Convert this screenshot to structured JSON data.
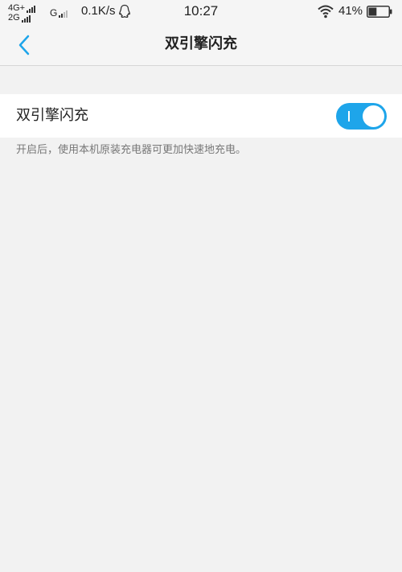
{
  "status_bar": {
    "network_top": "4G+",
    "network_bottom": "2G",
    "network_g": "G",
    "speed": "0.1K/s",
    "time": "10:27",
    "battery": "41%",
    "icons": [
      "signal-icon",
      "qq-icon",
      "wifi-icon",
      "battery-icon"
    ],
    "battery_level": 0.41
  },
  "header": {
    "title": "双引擎闪充",
    "back_icon": "back-arrow-icon",
    "accent_color": "#1ea5ea"
  },
  "setting": {
    "label": "双引擎闪充",
    "enabled": true,
    "toggle_color": "#1ea5ea",
    "description": "开启后，使用本机原装充电器可更加快速地充电。"
  }
}
